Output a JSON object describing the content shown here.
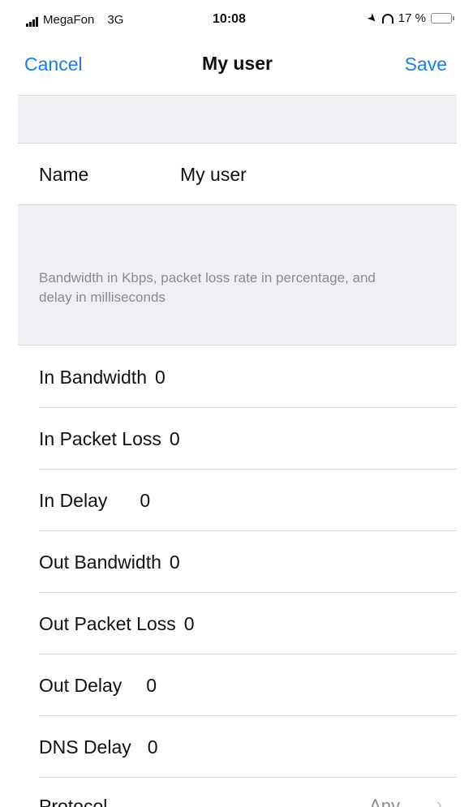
{
  "status_bar": {
    "carrier": "MegaFon",
    "network": "3G",
    "time": "10:08",
    "battery": "17 %",
    "battery_color": "#e0252b"
  },
  "nav": {
    "cancel_label": "Cancel",
    "title": "My user",
    "save_label": "Save",
    "accent_color": "#1a7ee8"
  },
  "name_row": {
    "label": "Name",
    "value": "My user"
  },
  "section_footer": "Bandwidth in Kbps, packet loss rate in percentage, and delay in milliseconds",
  "rows": [
    {
      "label": "In Bandwidth",
      "value": "0"
    },
    {
      "label": "In Packet Loss",
      "value": "0"
    },
    {
      "label": "In Delay",
      "value": "0"
    },
    {
      "label": "Out Bandwidth",
      "value": "0"
    },
    {
      "label": "Out Packet Loss",
      "value": "0"
    },
    {
      "label": "Out Delay",
      "value": "0"
    },
    {
      "label": "DNS Delay",
      "value": "0"
    }
  ],
  "partial_row": {
    "label": "Protocol",
    "detail": "Any"
  },
  "icons": [
    "signal-icon",
    "location-icon",
    "headphones-icon",
    "battery-icon",
    "chevron-right-icon"
  ]
}
